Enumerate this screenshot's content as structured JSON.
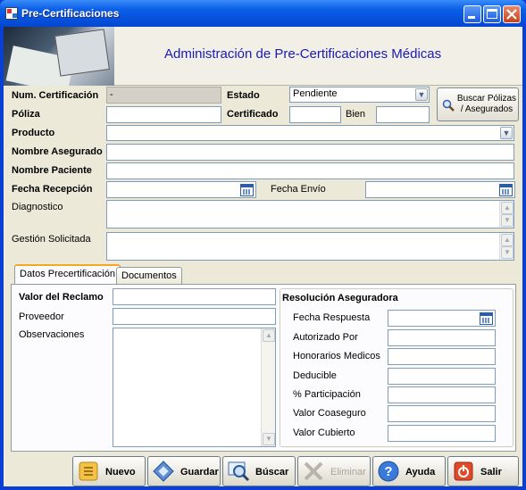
{
  "window": {
    "title": "Pre-Certificaciones"
  },
  "banner": {
    "title": "Administración de Pre-Certificaciones Médicas"
  },
  "form": {
    "num_certificacion": {
      "label": "Num. Certificación",
      "value": "-"
    },
    "estado": {
      "label": "Estado",
      "value": "Pendiente"
    },
    "poliza": {
      "label": "Póliza",
      "value": ""
    },
    "certificado": {
      "label": "Certificado",
      "value": ""
    },
    "bien": {
      "label": "Bien",
      "value": ""
    },
    "producto": {
      "label": "Producto",
      "value": ""
    },
    "nombre_asegurado": {
      "label": "Nombre Asegurado",
      "value": ""
    },
    "nombre_paciente": {
      "label": "Nombre Paciente",
      "value": ""
    },
    "fecha_recepcion": {
      "label": "Fecha Recepción",
      "value": ""
    },
    "fecha_envio": {
      "label": "Fecha Envío",
      "value": ""
    },
    "diagnostico": {
      "label": "Diagnostico",
      "value": ""
    },
    "gestion_solicitada": {
      "label": "Gestión Solicitada",
      "value": ""
    }
  },
  "search_button": {
    "label": "Buscar Pólizas / Asegurados",
    "icon": "magnifier-icon"
  },
  "tabs": [
    {
      "label": "Datos Precertificación",
      "active": true
    },
    {
      "label": "Documentos",
      "active": false
    }
  ],
  "tab_datos": {
    "valor_reclamo": {
      "label": "Valor del Reclamo",
      "value": ""
    },
    "proveedor": {
      "label": "Proveedor",
      "value": ""
    },
    "observaciones": {
      "label": "Observaciones",
      "value": ""
    },
    "resolucion": {
      "title": "Resolución Aseguradora",
      "fecha_respuesta": {
        "label": "Fecha Respuesta",
        "value": ""
      },
      "autorizado_por": {
        "label": "Autorizado Por",
        "value": ""
      },
      "honorarios_medicos": {
        "label": "Honorarios Medicos",
        "value": ""
      },
      "deducible": {
        "label": "Deducible",
        "value": ""
      },
      "participacion": {
        "label": "% Participación",
        "value": ""
      },
      "valor_coaseguro": {
        "label": "Valor Coaseguro",
        "value": ""
      },
      "valor_cubierto": {
        "label": "Valor Cubierto",
        "value": ""
      }
    }
  },
  "toolbar": {
    "nuevo": {
      "label": "Nuevo",
      "icon": "new-document-icon",
      "enabled": true
    },
    "guardar": {
      "label": "Guardar",
      "icon": "save-icon",
      "enabled": true
    },
    "buscar": {
      "label": "Búscar",
      "icon": "search-icon",
      "enabled": true
    },
    "eliminar": {
      "label": "Eliminar",
      "icon": "delete-icon",
      "enabled": false
    },
    "ayuda": {
      "label": "Ayuda",
      "icon": "help-icon",
      "enabled": true
    },
    "salir": {
      "label": "Salir",
      "icon": "exit-icon",
      "enabled": true
    }
  },
  "colors": {
    "title_accent": "#1a1ab4",
    "titlebar": "#0346d2",
    "window_bg": "#ece9d8",
    "tab_highlight": "#f5a623"
  }
}
